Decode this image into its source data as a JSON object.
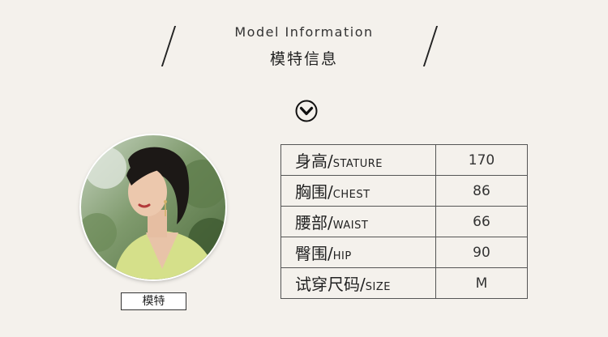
{
  "header": {
    "title_en": "Model Information",
    "title_cn": "模特信息"
  },
  "icons": {
    "divider": "chevron-down-circle-icon",
    "photo": "model-portrait"
  },
  "model": {
    "caption": "模特"
  },
  "measurements": [
    {
      "label_cn": "身高",
      "separator": "/",
      "label_en": "STATURE",
      "value": "170"
    },
    {
      "label_cn": "胸围",
      "separator": "/",
      "label_en": "CHEST",
      "value": "86"
    },
    {
      "label_cn": "腰部",
      "separator": "/",
      "label_en": "WAIST",
      "value": "66"
    },
    {
      "label_cn": "臀围",
      "separator": "/",
      "label_en": "HIP",
      "value": "90"
    },
    {
      "label_cn": "试穿尺码",
      "separator": "/",
      "label_en": "SIZE",
      "value": "M"
    }
  ],
  "colors": {
    "background": "#f4f1ec",
    "text": "#222222",
    "border": "#555555"
  }
}
